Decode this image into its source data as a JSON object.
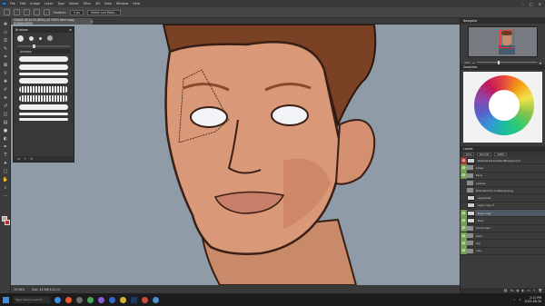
{
  "menubar": {
    "items": [
      "File",
      "Edit",
      "Image",
      "Layer",
      "Type",
      "Select",
      "Filter",
      "3D",
      "View",
      "Window",
      "Help"
    ],
    "window_controls": [
      "–",
      "□",
      "✕"
    ]
  },
  "optionsbar": {
    "feather_label": "Feather:",
    "feather_value": "0 px",
    "select_mask_label": "Select and Mask..."
  },
  "document": {
    "tab_title": "OHASE 8019 IN (60%) (Ø 330% face copy, RGB/8/CMYK)"
  },
  "statusbar": {
    "zoom": "39.58%",
    "doc_info": "Doc: 43.9M/1.02 ml"
  },
  "brushes": {
    "title": "Brushes",
    "group_label": "Aviation"
  },
  "navigator": {
    "title": "Navigator",
    "zoom": "33%"
  },
  "swatches": {
    "title": "Swatches"
  },
  "layers": {
    "title": "Layers",
    "kind_label": "Kind",
    "blend_mode": "Normal",
    "opacity": "100%",
    "rows": [
      {
        "name": "Default parameter/Background",
        "type": "layer",
        "vis": "red",
        "selected": false
      },
      {
        "name": "Lines",
        "type": "folder",
        "vis": "on",
        "selected": false
      },
      {
        "name": "Face",
        "type": "folder",
        "vis": "on",
        "selected": false
      },
      {
        "name": "Leaves",
        "type": "folder",
        "vis": "",
        "selected": false
      },
      {
        "name": "Brainstorm's creatures.png",
        "type": "folder",
        "vis": "",
        "selected": false
      },
      {
        "name": "eyes/liner",
        "type": "layer",
        "vis": "",
        "selected": false
      },
      {
        "name": "eyes copy 2",
        "type": "layer",
        "vis": "",
        "selected": false
      },
      {
        "name": "face copy",
        "type": "layer",
        "vis": "on",
        "selected": true
      },
      {
        "name": "face",
        "type": "layer",
        "vis": "on",
        "selected": false
      },
      {
        "name": "scrunched",
        "type": "folder",
        "vis": "on",
        "selected": false
      },
      {
        "name": "skull",
        "type": "folder",
        "vis": "on",
        "selected": false
      },
      {
        "name": "dry",
        "type": "folder",
        "vis": "on",
        "selected": false
      },
      {
        "name": "clay",
        "type": "folder",
        "vis": "on",
        "selected": false
      }
    ]
  },
  "taskbar": {
    "search_placeholder": "Type here to search",
    "time": "2:11 PM",
    "date": "2022-09-30"
  },
  "colors": {
    "canvas_bg": "#8f9ba6",
    "skin": "#d99877",
    "hair": "#7a4124",
    "foreground": "#c9a18f",
    "background": "#c22b2b"
  }
}
